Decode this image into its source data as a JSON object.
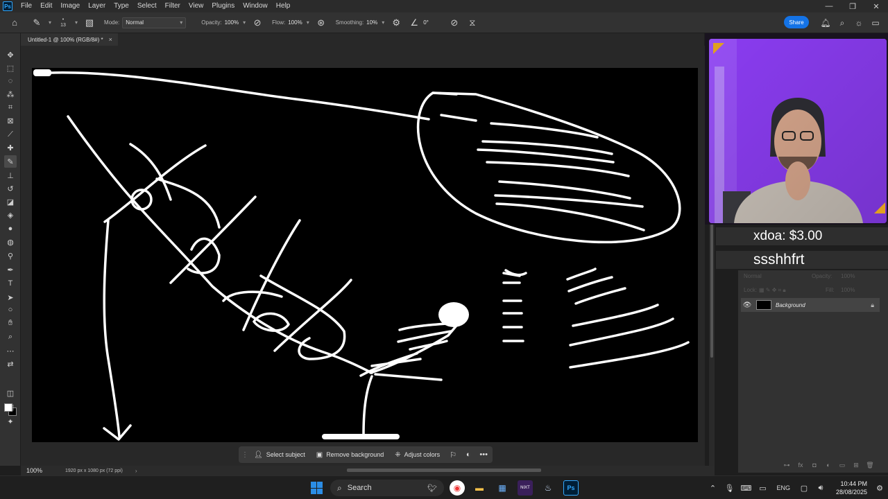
{
  "app": {
    "logo": "Ps",
    "menu": [
      "File",
      "Edit",
      "Image",
      "Layer",
      "Type",
      "Select",
      "Filter",
      "View",
      "Plugins",
      "Window",
      "Help"
    ],
    "window_controls": [
      "—",
      "❐",
      "✕"
    ]
  },
  "options_bar": {
    "brush_size": "13",
    "mode_label": "Mode:",
    "mode_value": "Normal",
    "opacity_label": "Opacity:",
    "opacity_value": "100%",
    "flow_label": "Flow:",
    "flow_value": "100%",
    "smoothing_label": "Smoothing:",
    "smoothing_value": "10%",
    "angle_value": "0°",
    "share_label": "Share"
  },
  "document": {
    "tab_title": "Untitled-1 @ 100% (RGB/8#) *",
    "close": "×"
  },
  "status": {
    "zoom": "100%",
    "doc_size": "1920 px x 1080 px (72 ppi)",
    "arrow": "›"
  },
  "context_bar": {
    "select_subject": "Select subject",
    "remove_background": "Remove background",
    "adjust_colors": "Adjust colors",
    "more": "•••"
  },
  "overlay": {
    "alert_1": "xdoa: $3.00",
    "alert_2": "ssshhfrt"
  },
  "layers": {
    "blend_mode": "Normal",
    "opacity_label": "Opacity:",
    "opacity_value": "100%",
    "lock_label": "Lock:",
    "fill_label": "Fill:",
    "fill_value": "100%",
    "layer_name": "Background"
  },
  "taskbar": {
    "search_label": "Search",
    "language": "ENG",
    "time": "10:44 PM",
    "date": "28/08/2025",
    "nixt_label": "NIXT",
    "ps_label": "Ps"
  }
}
